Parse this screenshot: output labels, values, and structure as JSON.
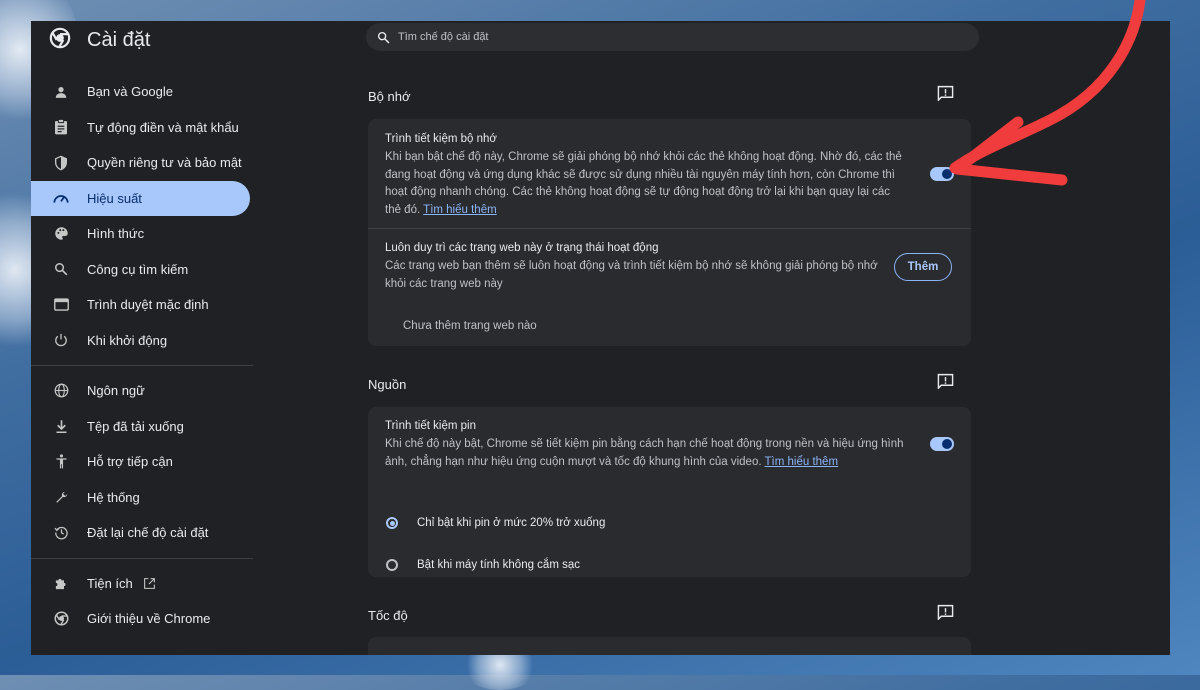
{
  "settings_title": "Cài đặt",
  "search": {
    "placeholder": "Tìm chế độ cài đặt"
  },
  "nav": [
    {
      "label": "Bạn và Google",
      "icon": "person-icon"
    },
    {
      "label": "Tự động điền và mật khẩu",
      "icon": "clipboard-icon"
    },
    {
      "label": "Quyền riêng tư và bảo mật",
      "icon": "shield-icon"
    },
    {
      "label": "Hiệu suất",
      "icon": "speedometer-icon"
    },
    {
      "label": "Hình thức",
      "icon": "palette-icon"
    },
    {
      "label": "Công cụ tìm kiếm",
      "icon": "search-icon"
    },
    {
      "label": "Trình duyệt mặc định",
      "icon": "browser-icon"
    },
    {
      "label": "Khi khởi động",
      "icon": "power-icon"
    },
    {
      "label": "Ngôn ngữ",
      "icon": "globe-icon"
    },
    {
      "label": "Tệp đã tải xuống",
      "icon": "download-icon"
    },
    {
      "label": "Hỗ trợ tiếp cận",
      "icon": "accessibility-icon"
    },
    {
      "label": "Hệ thống",
      "icon": "wrench-icon"
    },
    {
      "label": "Đặt lại chế độ cài đặt",
      "icon": "history-icon"
    },
    {
      "label": "Tiện ích",
      "icon": "puzzle-icon"
    },
    {
      "label": "Giới thiệu về Chrome",
      "icon": "chrome-icon"
    }
  ],
  "memory": {
    "section_title": "Bộ nhớ",
    "saver_title": "Trình tiết kiệm bộ nhớ",
    "saver_desc": "Khi bạn bật chế độ này, Chrome sẽ giải phóng bộ nhớ khỏi các thẻ không hoạt động. Nhờ đó, các thẻ đang hoạt động và ứng dụng khác sẽ được sử dụng nhiều tài nguyên máy tính hơn, còn Chrome thì hoạt động nhanh chóng. Các thẻ không hoạt động sẽ tự động hoạt động trở lại khi bạn quay lại các thẻ đó.",
    "learn_more": "Tìm hiểu thêm",
    "keep_active_title": "Luôn duy trì các trang web này ở trạng thái hoạt động",
    "keep_active_desc": "Các trang web bạn thêm sẽ luôn hoạt động và trình tiết kiệm bộ nhớ sẽ không giải phóng bộ nhớ khỏi các trang web này",
    "add_button": "Thêm",
    "empty_text": "Chưa thêm trang web nào"
  },
  "power": {
    "section_title": "Nguồn",
    "saver_title": "Trình tiết kiệm pin",
    "saver_desc": "Khi chế độ này bật, Chrome sẽ tiết kiệm pin bằng cách hạn chế hoạt động trong nền và hiệu ứng hình ảnh, chẳng hạn như hiệu ứng cuộn mượt và tốc độ khung hình của video.",
    "learn_more": "Tìm hiểu thêm",
    "option_1": "Chỉ bật khi pin ở mức 20% trở xuống",
    "option_2": "Bật khi máy tính không cắm sạc"
  },
  "speed": {
    "section_title": "Tốc độ"
  }
}
